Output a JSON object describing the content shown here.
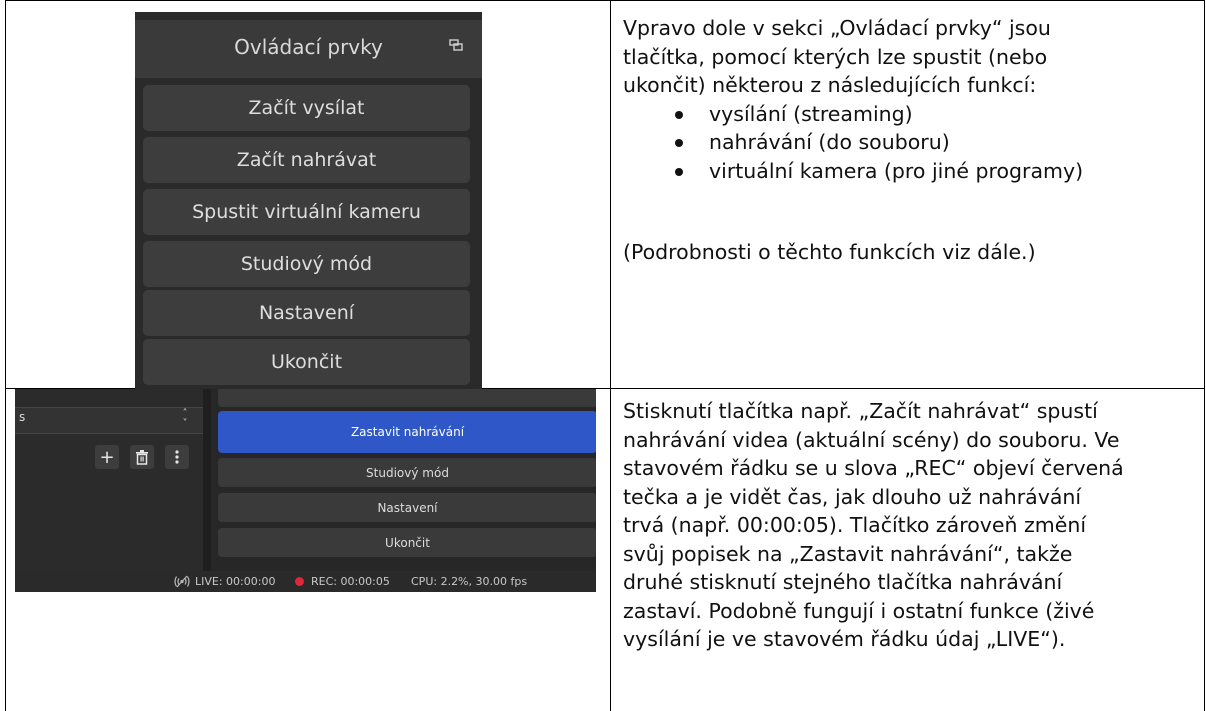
{
  "top_row": {
    "screenshot": {
      "dock_title": "Ovládací prvky",
      "buttons": [
        "Začít vysílat",
        "Začít nahrávat",
        "Spustit virtuální kameru",
        "Studiový mód",
        "Nastavení",
        "Ukončit"
      ]
    },
    "text": {
      "intro_lines": [
        "Vpravo dole v sekci „Ovládací prvky“ jsou",
        "tlačítka, pomocí kterých lze spustit (nebo",
        "ukončit) některou z následujících funkcí:"
      ],
      "bullets": [
        "vysílání (streaming)",
        "nahrávání (do souboru)",
        "virtuální kamera (pro jiné programy)"
      ],
      "note": "(Podrobnosti o těchto funkcích viz dále.)"
    }
  },
  "bottom_row": {
    "screenshot": {
      "left_panel_item": "s",
      "buttons": {
        "stop_recording": "Zastavit nahrávání",
        "studio_mode": "Studiový mód",
        "settings": "Nastavení",
        "exit": "Ukončit"
      },
      "status": {
        "live": "LIVE: 00:00:00",
        "rec": "REC: 00:00:05",
        "cpu": "CPU: 2.2%, 30.00 fps"
      }
    },
    "text": {
      "lines": [
        "Stisknutí tlačítka např. „Začít nahrávat“ spustí",
        "nahrávání videa (aktuální scény) do souboru. Ve",
        "stavovém řádku se u slova „REC“ objeví červená",
        "tečka a je vidět čas, jak dlouho už nahrávání",
        "trvá (např. 00:00:05). Tlačítko zároveň změní",
        "svůj popisek na „Zastavit nahrávání“, takže",
        "druhé stisknutí stejného tlačítka nahrávání",
        "zastaví. Podobně fungují i ostatní funkce (živé",
        "vysílání je ve stavovém řádku údaj „LIVE“)."
      ]
    }
  },
  "colors": {
    "active_button": "#2f57c7",
    "rec_dot": "#e0263a"
  }
}
